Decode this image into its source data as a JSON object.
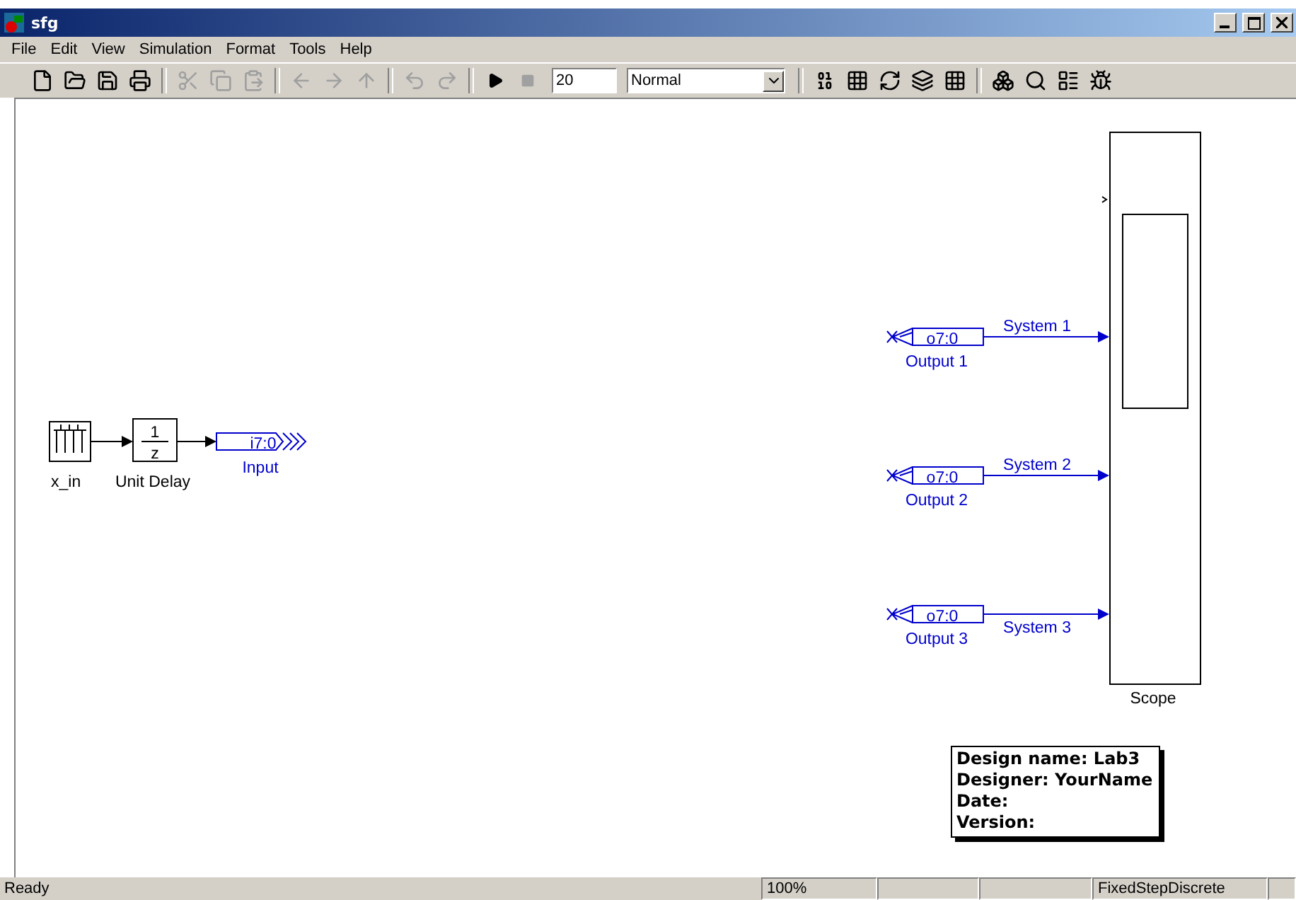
{
  "window": {
    "title": "sfg"
  },
  "menu": [
    "File",
    "Edit",
    "View",
    "Simulation",
    "Format",
    "Tools",
    "Help"
  ],
  "toolbar": {
    "stop_time": "20",
    "mode": "Normal"
  },
  "diagram": {
    "source": {
      "label": "x_in"
    },
    "unit_delay": {
      "numerator": "1",
      "denominator": "z",
      "label": "Unit Delay"
    },
    "input_gateway": {
      "text": "i7:0",
      "label": "Input"
    },
    "output_gateways": [
      {
        "text": "o7:0",
        "label": "Output 1",
        "signal": "System 1"
      },
      {
        "text": "o7:0",
        "label": "Output 2",
        "signal": "System 2"
      },
      {
        "text": "o7:0",
        "label": "Output 3",
        "signal": "System 3"
      }
    ],
    "scope": {
      "label": "Scope"
    },
    "design_info": [
      "Design name: Lab3",
      "Designer: YourName",
      "Date:",
      "Version:"
    ]
  },
  "status_bar": {
    "message": "Ready",
    "zoom": "100%",
    "solver": "FixedStepDiscrete"
  }
}
